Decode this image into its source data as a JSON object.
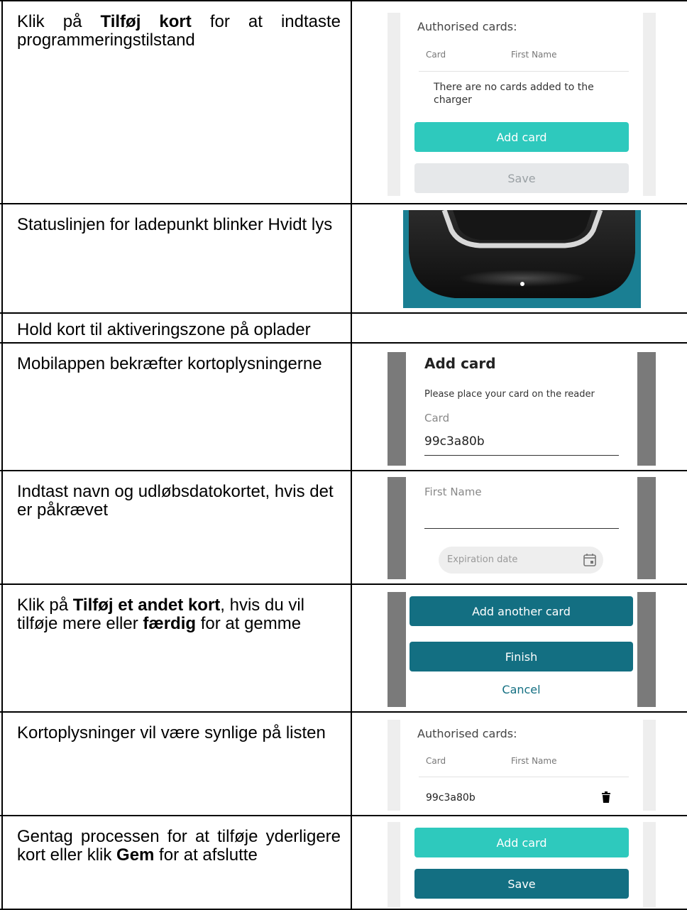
{
  "rows": [
    {
      "text_parts": [
        "Klik på ",
        "Tilføj kort",
        " for at indtaste programmeringstilstand"
      ],
      "screen": {
        "header": "Authorised cards:",
        "col_card": "Card",
        "col_first_name": "First Name",
        "empty_message": "There are no cards added to the charger",
        "add_card_label": "Add card",
        "save_label": "Save"
      }
    },
    {
      "text": "Statuslinjen for ladepunkt blinker Hvidt lys",
      "photo": {
        "status_light_color": "#ffffff",
        "background_color": "#1a7f93"
      }
    },
    {
      "text": "Hold kort til aktiveringszone på oplader"
    },
    {
      "text": "Mobilappen bekræfter kortoplysningerne",
      "screen": {
        "title": "Add card",
        "instruction": "Please place your card on the reader",
        "card_label": "Card",
        "card_value": "99c3a80b"
      }
    },
    {
      "text": "Indtast navn og udløbsdatokortet, hvis det er påkrævet",
      "screen": {
        "first_name_placeholder": "First Name",
        "expiration_placeholder": "Expiration date",
        "calendar_icon": "calendar-icon"
      }
    },
    {
      "text_parts": [
        "Klik på ",
        "Tilføj et andet kort",
        ", hvis du vil tilføje mere eller ",
        "færdig",
        " for at gemme"
      ],
      "screen": {
        "add_another_label": "Add another card",
        "finish_label": "Finish",
        "cancel_label": "Cancel"
      }
    },
    {
      "text": "Kortoplysninger vil være synlige på listen",
      "screen": {
        "header": "Authorised cards:",
        "col_card": "Card",
        "col_first_name": "First Name",
        "card_value": "99c3a80b",
        "delete_icon": "trash-icon"
      }
    },
    {
      "text_parts": [
        "Gentag processen for at tilføje yderligere kort eller klik ",
        "Gem",
        " for at afslutte"
      ],
      "screen": {
        "add_card_label": "Add card",
        "save_label": "Save"
      }
    }
  ],
  "colors": {
    "teal": "#2ec9bd",
    "dark_teal": "#136f82",
    "grey_button": "#e6e8ea"
  }
}
